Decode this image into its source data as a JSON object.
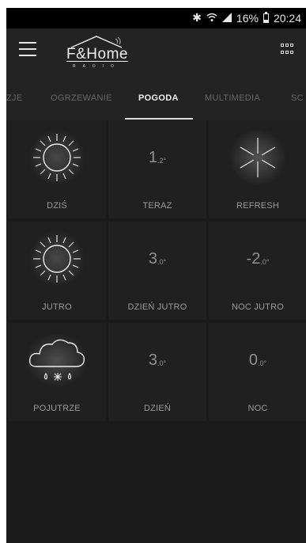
{
  "status_bar": {
    "battery": "16%",
    "time": "20:24"
  },
  "app": {
    "logo_text": "F&Home",
    "logo_sub": "RADIO"
  },
  "tabs": [
    {
      "label": "ZJE",
      "active": false
    },
    {
      "label": "OGRZEWANIE",
      "active": false
    },
    {
      "label": "POGODA",
      "active": true
    },
    {
      "label": "MULTIMEDIA",
      "active": false
    },
    {
      "label": "SC",
      "active": false
    }
  ],
  "tiles": {
    "today": {
      "label": "DZIŚ",
      "icon": "sun-icon"
    },
    "now": {
      "label": "TERAZ",
      "temp_int": "1",
      "temp_dec": ".2°"
    },
    "refresh": {
      "label": "REFRESH",
      "icon": "refresh-star-icon"
    },
    "tomorrow": {
      "label": "JUTRO",
      "icon": "sun-icon"
    },
    "day_tomorrow": {
      "label": "DZIEŃ JUTRO",
      "temp_int": "3",
      "temp_dec": ".0°"
    },
    "night_tomorrow": {
      "label": "NOC JUTRO",
      "temp_int": "-2",
      "temp_dec": ".0°"
    },
    "after_tomorrow": {
      "label": "POJUTRZE",
      "icon": "cloud-rain-snow-icon"
    },
    "day": {
      "label": "DZIEŃ",
      "temp_int": "3",
      "temp_dec": ".0°"
    },
    "night": {
      "label": "NOC",
      "temp_int": "0",
      "temp_dec": ".0°"
    }
  },
  "colors": {
    "background": "#1b1b1b",
    "tile": "#202020",
    "accent_text": "#f0f0f0",
    "muted_text": "#9a9a9a"
  }
}
